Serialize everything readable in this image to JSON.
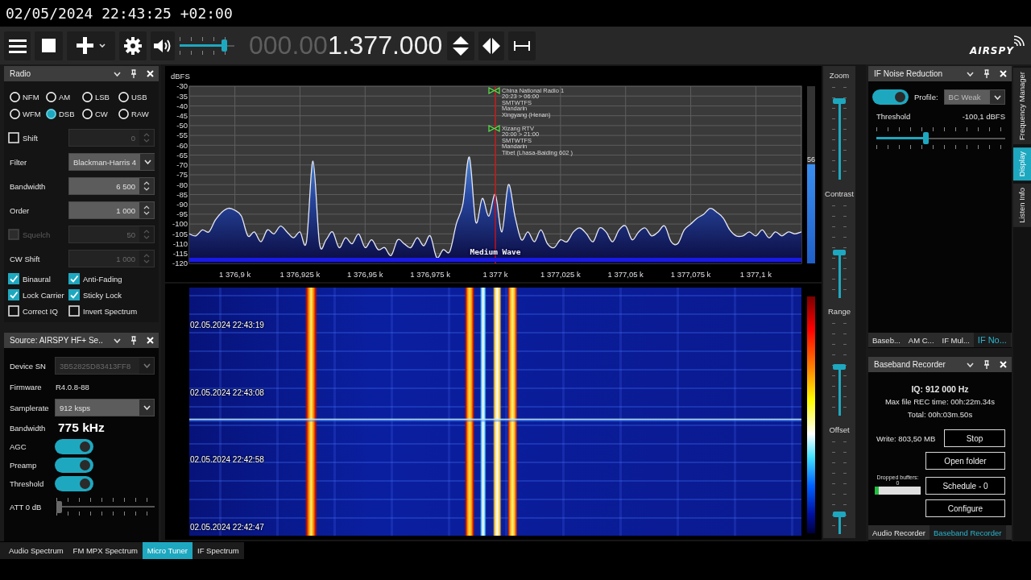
{
  "recording_overlay": {
    "timestamp": "02/05/2024 22:43:25 +02:00"
  },
  "toolbar": {
    "volume": {
      "level": 0.85
    },
    "frequency": {
      "prefix": "000.00",
      "value": "1.377.000"
    },
    "logo": "AIRSPY"
  },
  "radio_panel": {
    "title": "Radio",
    "modes": [
      {
        "label": "NFM",
        "selected": false
      },
      {
        "label": "AM",
        "selected": false
      },
      {
        "label": "LSB",
        "selected": false
      },
      {
        "label": "USB",
        "selected": false
      },
      {
        "label": "WFM",
        "selected": false
      },
      {
        "label": "DSB",
        "selected": true
      },
      {
        "label": "CW",
        "selected": false
      },
      {
        "label": "RAW",
        "selected": false
      }
    ],
    "rows": [
      {
        "kind": "check-spinner",
        "label": "Shift",
        "checked": false,
        "disabled": false,
        "value": "0",
        "field_disabled": true
      },
      {
        "kind": "dropdown",
        "label": "Filter",
        "value": "Blackman-Harris 4",
        "disabled": false,
        "field_disabled": false
      },
      {
        "kind": "spinner",
        "label": "Bandwidth",
        "value": "6 500",
        "disabled": false,
        "field_disabled": false
      },
      {
        "kind": "spinner",
        "label": "Order",
        "value": "1 000",
        "disabled": false,
        "field_disabled": false
      },
      {
        "kind": "check-spinner",
        "label": "Squelch",
        "checked": false,
        "disabled": true,
        "value": "50",
        "field_disabled": true
      },
      {
        "kind": "spinner",
        "label": "CW Shift",
        "value": "1 000",
        "disabled": false,
        "field_disabled": true
      }
    ],
    "options": [
      {
        "label": "Binaural",
        "checked": true
      },
      {
        "label": "Anti-Fading",
        "checked": true
      },
      {
        "label": "Lock Carrier",
        "checked": true
      },
      {
        "label": "Sticky Lock",
        "checked": true
      },
      {
        "label": "Correct IQ",
        "checked": false
      },
      {
        "label": "Invert Spectrum",
        "checked": false
      }
    ]
  },
  "source_panel": {
    "title": "Source: AIRSPY HF+ Se..",
    "rows": [
      {
        "kind": "dropdown",
        "label": "Device SN",
        "value": "3B52825D83413FF8",
        "field_disabled": true
      },
      {
        "kind": "text",
        "label": "Firmware",
        "value": "R4.0.8-88"
      },
      {
        "kind": "dropdown",
        "label": "Samplerate",
        "value": "912 ksps",
        "field_disabled": false
      },
      {
        "kind": "big-text",
        "label": "Bandwidth",
        "value": "775 kHz"
      },
      {
        "kind": "toggle",
        "label": "AGC",
        "on": true
      },
      {
        "kind": "toggle",
        "label": "Preamp",
        "on": true
      },
      {
        "kind": "toggle",
        "label": "Threshold",
        "on": true
      },
      {
        "kind": "slider",
        "label": "ATT 0 dB",
        "level": 0
      }
    ]
  },
  "spectrum": {
    "chart_data": {
      "type": "area",
      "ylabel": "dBFS",
      "grid": true,
      "x": [
        1376.8825,
        1376.885,
        1376.8875,
        1376.89,
        1376.8925,
        1376.895,
        1376.8975,
        1376.9,
        1376.9025,
        1376.905,
        1376.9075,
        1376.91,
        1376.9125,
        1376.915,
        1376.9175,
        1376.92,
        1376.9225,
        1376.925,
        1376.9275,
        1376.93,
        1376.9325,
        1376.935,
        1376.9375,
        1376.94,
        1376.9425,
        1376.945,
        1376.9475,
        1376.95,
        1376.9525,
        1376.955,
        1376.9575,
        1376.96,
        1376.9625,
        1376.965,
        1376.9675,
        1376.97,
        1376.9725,
        1376.975,
        1376.9775,
        1376.98,
        1376.9825,
        1376.985,
        1376.9875,
        1376.99,
        1376.9925,
        1376.995,
        1376.9975,
        1377,
        1377.0025,
        1377.005,
        1377.0075,
        1377.01,
        1377.0125,
        1377.015,
        1377.0175,
        1377.02,
        1377.0225,
        1377.025,
        1377.0275,
        1377.03,
        1377.0325,
        1377.035,
        1377.0375,
        1377.04,
        1377.0425,
        1377.045,
        1377.0475,
        1377.05,
        1377.0525,
        1377.055,
        1377.0575,
        1377.06,
        1377.0625,
        1377.065,
        1377.0675,
        1377.07,
        1377.0725,
        1377.075,
        1377.0775,
        1377.08,
        1377.0825,
        1377.085,
        1377.0875,
        1377.09,
        1377.0925,
        1377.095,
        1377.0975,
        1377.1,
        1377.1025,
        1377.105,
        1377.1075,
        1377.11,
        1377.1125,
        1377.115,
        1377.1175
      ],
      "series": [
        {
          "color": "#e8e8f2",
          "values": [
            -105,
            -106,
            -103,
            -104,
            -98,
            -94,
            -92,
            -93,
            -96,
            -106,
            -104,
            -109,
            -103,
            -105,
            -101,
            -104,
            -107,
            -104,
            -109,
            -68,
            -110,
            -108,
            -104,
            -112,
            -107,
            -110,
            -105,
            -112,
            -108,
            -113,
            -112,
            -116,
            -108,
            -110,
            -112,
            -107,
            -111,
            -106,
            -117,
            -113,
            -114,
            -100,
            -90,
            -66,
            -99,
            -87,
            -96,
            -85,
            -104,
            -80,
            -96,
            -108,
            -104,
            -109,
            -103,
            -110,
            -112,
            -108,
            -109,
            -104,
            -102,
            -105,
            -109,
            -102,
            -104,
            -109,
            -103,
            -101,
            -108,
            -104,
            -102,
            -106,
            -104,
            -101,
            -109,
            -110,
            -103,
            -100,
            -97,
            -95,
            -92,
            -94,
            -97,
            -103,
            -106,
            -106,
            -104,
            -106,
            -103,
            -107,
            -104,
            -106,
            -104,
            -105,
            -104
          ]
        }
      ],
      "xlim": [
        1376.8825,
        1377.1175
      ],
      "ylim": [
        -120,
        -30
      ],
      "xticks": [
        {
          "value": 1376.9,
          "label": "1 376,9 k"
        },
        {
          "value": 1376.925,
          "label": "1 376,925 k"
        },
        {
          "value": 1376.95,
          "label": "1 376,95 k"
        },
        {
          "value": 1376.975,
          "label": "1 376,975 k"
        },
        {
          "value": 1377,
          "label": "1 377 k"
        },
        {
          "value": 1377.025,
          "label": "1 377,025 k"
        },
        {
          "value": 1377.05,
          "label": "1 377,05 k"
        },
        {
          "value": 1377.075,
          "label": "1 377,075 k"
        },
        {
          "value": 1377.1,
          "label": "1 377,1 k"
        }
      ],
      "yticks": [
        -30,
        -35,
        -40,
        -45,
        -50,
        -55,
        -60,
        -65,
        -70,
        -75,
        -80,
        -85,
        -90,
        -95,
        -100,
        -105,
        -110,
        -115,
        -120
      ],
      "ref_lines": [
        {
          "axis": "x",
          "value": 1377,
          "color": "#d01010"
        }
      ],
      "annotations": [
        "China National Radio 1\n20:23 > 06:00\nSMTWTFS\nMandarin\nXingyang (Henan)",
        "Xizang RTV\n20:00 > 21:00\nSMTWTFS\nMandarin\nTibet (Lhasa-Baiding  602 )"
      ]
    },
    "band": {
      "label": "Medium Wave"
    },
    "signal_meter": {
      "level": 0.56,
      "reading": "56"
    }
  },
  "waterfall": {
    "timestamps": [
      "02.05.2024 22:43:19",
      "02.05.2024 22:43:08",
      "02.05.2024 22:42:58",
      "02.05.2024 22:42:47"
    ]
  },
  "display_controls": [
    {
      "label": "Zoom",
      "level": 0.87
    },
    {
      "label": "Contrast",
      "level": 0.49
    },
    {
      "label": "Range",
      "level": 0.53
    },
    {
      "label": "Offset",
      "level": 0.19
    }
  ],
  "noise_reduction_panel": {
    "title": "IF Noise Reduction",
    "toggle": {
      "on": true
    },
    "profile_label": "Profile:",
    "profile": "BC Weak",
    "threshold_label": "Threshold",
    "threshold_reading": "-100,1 dBFS",
    "threshold_slider": {
      "level": 0.38
    },
    "tabs": [
      {
        "label": "Baseb...",
        "selected": false
      },
      {
        "label": "AM C...",
        "selected": false
      },
      {
        "label": "IF Mul...",
        "selected": false
      },
      {
        "label": "IF No...",
        "selected": true
      }
    ]
  },
  "side_tabs": [
    {
      "label": "Frequency Manager",
      "selected": false
    },
    {
      "label": "Display",
      "selected": true
    },
    {
      "label": "Listen Info",
      "selected": false
    }
  ],
  "recorder_panel": {
    "title": "Baseband Recorder",
    "iq": "IQ: 912 000 Hz",
    "max_time": "Max file REC time: 00h:22m.34s",
    "total": "Total: 00h:03m.50s",
    "write": "Write:  803,50 MB",
    "dropped": "Dropped buffers: 0",
    "buffer": {
      "level": 0.08
    },
    "buttons": [
      "Stop",
      "Open folder",
      "Schedule - 0",
      "Configure"
    ],
    "tabs": [
      {
        "label": "Audio Recorder",
        "selected": false
      },
      {
        "label": "Baseband Recorder",
        "selected": true
      }
    ]
  },
  "bottom_tabs": [
    {
      "label": "Audio Spectrum",
      "selected": false
    },
    {
      "label": "FM MPX Spectrum",
      "selected": false
    },
    {
      "label": "Micro Tuner",
      "selected": true
    },
    {
      "label": "IF Spectrum",
      "selected": false
    }
  ]
}
